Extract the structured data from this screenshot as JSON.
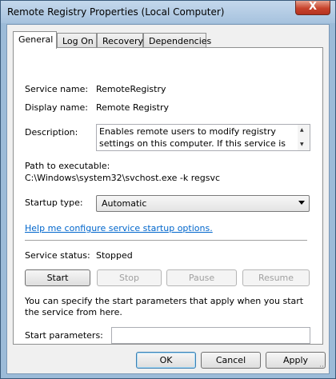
{
  "window": {
    "title": "Remote Registry Properties (Local Computer)",
    "close_glyph": "X"
  },
  "tabs": [
    {
      "label": "General",
      "active": true
    },
    {
      "label": "Log On",
      "active": false
    },
    {
      "label": "Recovery",
      "active": false
    },
    {
      "label": "Dependencies",
      "active": false
    }
  ],
  "general": {
    "service_name_label": "Service name:",
    "service_name": "RemoteRegistry",
    "display_name_label": "Display name:",
    "display_name": "Remote Registry",
    "description_label": "Description:",
    "description": "Enables remote users to modify registry settings on this computer. If this service is stopped, the registry",
    "path_label": "Path to executable:",
    "path": "C:\\Windows\\system32\\svchost.exe -k regsvc",
    "startup_type_label": "Startup type:",
    "startup_type": "Automatic",
    "help_link": "Help me configure service startup options.",
    "status_label": "Service status:",
    "status": "Stopped",
    "buttons": {
      "start": "Start",
      "stop": "Stop",
      "pause": "Pause",
      "resume": "Resume"
    },
    "start_params_note": "You can specify the start parameters that apply when you start the service from here.",
    "start_params_label": "Start parameters:",
    "start_params_value": ""
  },
  "footer": {
    "ok": "OK",
    "cancel": "Cancel",
    "apply": "Apply"
  }
}
